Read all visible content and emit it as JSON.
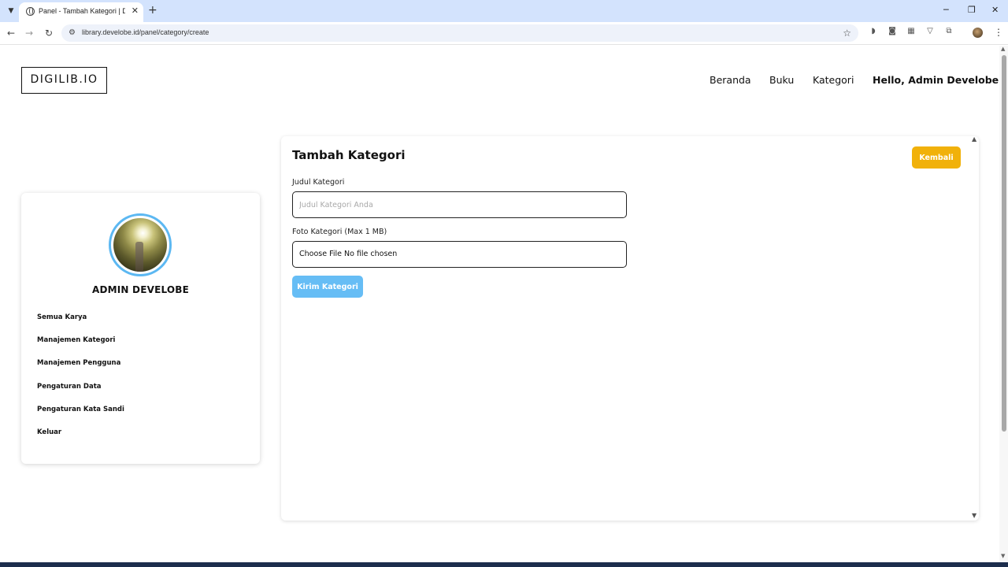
{
  "browser": {
    "tab_title": "Panel - Tambah Kategori | DIGILIB.IO",
    "tab_close": "✕",
    "new_tab": "+",
    "url": "library.develobe.id/panel/category/create",
    "icons": {
      "back": "arrow-left-icon",
      "forward": "arrow-right-icon",
      "reload": "reload-icon",
      "bookmark": "star-icon",
      "menu": "kebab-menu-icon"
    },
    "window_controls": {
      "minimize": "─",
      "restore": "❐",
      "close": "✕"
    }
  },
  "header": {
    "logo": "DIGILIB.IO",
    "nav": [
      "Beranda",
      "Buku",
      "Kategori"
    ],
    "greeting": "Hello, Admin Develobe"
  },
  "sidebar": {
    "name": "ADMIN DEVELOBE",
    "ring_color": "#5cb8f2",
    "menu": [
      "Semua Karya",
      "Manajemen Kategori",
      "Manajemen Pengguna",
      "Pengaturan Data",
      "Pengaturan Kata Sandi",
      "Keluar"
    ]
  },
  "form": {
    "title": "Tambah Kategori",
    "back_label": "Kembali",
    "back_color": "#f1b10a",
    "title_label": "Judul Kategori",
    "title_value": "",
    "title_placeholder": "Judul Kategori Anda",
    "photo_label": "Foto Kategori (Max 1 MB)",
    "file_button": "Choose File",
    "file_status": "No file chosen",
    "submit_label": "Kirim Kategori",
    "submit_color": "#66bdf5"
  }
}
